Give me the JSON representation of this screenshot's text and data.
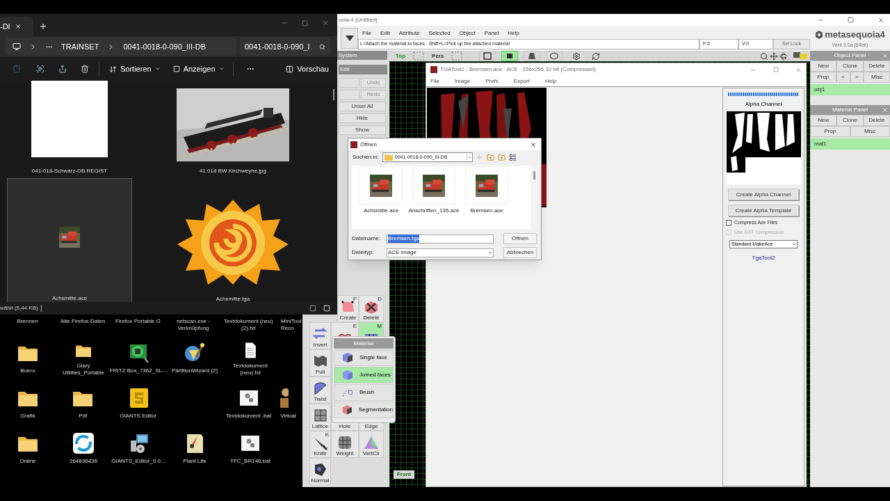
{
  "explorer": {
    "tab_title": "-DI",
    "path": [
      "TRAINSET",
      "0041-0018-0-090_III-DB"
    ],
    "search": {
      "value": "0041-0018-0-090_I"
    },
    "toolbar": {
      "sort": "Sortieren",
      "view": "Anzeigen",
      "preview": "Vorschau"
    },
    "files": [
      {
        "name": "041-018-Schwarz-DB.REGIST",
        "kind": "blank",
        "selected": false
      },
      {
        "name": "41 018 BW Kirchweyhe.jpg",
        "selected": false
      },
      {
        "name": "Achsmitte.ace",
        "kind": "thumb",
        "selected": true
      },
      {
        "name": "Achsmitte.tga",
        "kind": "logo",
        "selected": false
      }
    ],
    "status": "wählt (5,44 KB)"
  },
  "desktop": {
    "top_labels": [
      "Brennen",
      "Alte Firefox-Daten",
      "Firefox Portable G",
      "netscan.exe - Verknüpfung",
      "Textdokument (neu) (2).txt",
      "MiniTool Reco"
    ],
    "rows": [
      [
        {
          "name": "Buero",
          "kind": "folder"
        },
        {
          "name": "Glary Utilities_Portable",
          "kind": "folder"
        },
        {
          "name": "FRITZ.Box_7362_SL-...",
          "kind": "board"
        },
        {
          "name": "PartitionWizard (2)",
          "kind": "wizard"
        },
        {
          "name": "Textdokument (neu).txt",
          "kind": "document"
        }
      ],
      [
        {
          "name": "Grafik",
          "kind": "folder"
        },
        {
          "name": "Pdf",
          "kind": "folder"
        },
        {
          "name": "GIANTS Editor",
          "kind": "tile"
        },
        {
          "kind": "gap"
        },
        {
          "name": "Textdokument .bat",
          "kind": "script"
        },
        {
          "name": "Virtual",
          "kind": "figure"
        }
      ],
      [
        {
          "name": "Online",
          "kind": "folder"
        },
        {
          "name": "264836436",
          "kind": "sync"
        },
        {
          "name": "GIANTS_Editor_9.0....",
          "kind": "installer"
        },
        {
          "name": "Plant Life",
          "kind": "rocket"
        },
        {
          "name": "TFC_BR146.bat",
          "kind": "script"
        }
      ]
    ]
  },
  "meta": {
    "title": "uoia 4 [Untitled]",
    "menu": [
      "File",
      "Edit",
      "Attribute",
      "Selected",
      "Object",
      "Panel",
      "Help"
    ],
    "hint": "L=Attach the material to faces.  Shift+L=Pick up the attached material",
    "faces": "F:0",
    "vertices": "V:0",
    "sel_lock": "Sel Lock",
    "logo": "metasequoia4",
    "version": "Ver4.9.0a (64bit)",
    "system_tab": "System",
    "edit_tab": "Edit",
    "edit_buttons": [
      {
        "label": "Undo",
        "disabled": true
      },
      {
        "label": "Redo",
        "disabled": true
      },
      {
        "label": "Unsel All",
        "disabled": false
      },
      {
        "label": "Hide",
        "disabled": false
      },
      {
        "label": "Show",
        "disabled": false
      }
    ],
    "views": [
      {
        "label": "Top",
        "selected": true
      },
      {
        "label": "Pers",
        "selected": false
      }
    ],
    "shading_buttons": [
      {
        "selected": false
      },
      {
        "selected": true
      },
      {
        "selected": false
      },
      {
        "selected": false
      }
    ],
    "tool_rows": [
      [
        {
          "label": "Create",
          "key": "F",
          "selected": false
        },
        {
          "label": "Delete",
          "key": "D",
          "selected": false
        }
      ],
      [
        {
          "label": "Invert",
          "selected": false
        },
        {
          "key": "E",
          "selected": false
        },
        {
          "key": "M",
          "selected": true
        }
      ],
      [
        {
          "label": "Pull",
          "selected": false
        }
      ],
      [
        {
          "label": "Twist",
          "selected": false
        }
      ],
      [
        {
          "label": "Lattice",
          "selected": false
        },
        {
          "label": "Hole",
          "selected": false
        },
        {
          "label": "Edge",
          "selected": false
        }
      ],
      [
        {
          "label": "Knife",
          "key": "K",
          "selected": false
        },
        {
          "label": "Weight",
          "selected": false
        },
        {
          "label": "VertClr",
          "selected": false
        }
      ],
      [
        {
          "label": "Normal",
          "selected": false
        }
      ]
    ],
    "viewport_label": "Front",
    "object_panel": {
      "title": "Object Panel",
      "buttons": [
        "New",
        "Clone",
        "Delete"
      ],
      "buttons2": [
        "Prop",
        "<",
        ">",
        "Misc"
      ],
      "items": [
        {
          "name": "obj1",
          "selected": true
        }
      ]
    },
    "material_panel": {
      "title": "Material Panel",
      "buttons": [
        "New",
        "Clone",
        "Delete"
      ],
      "buttons2": [
        "Prop",
        "Misc"
      ],
      "items": [
        {
          "name": "mat1",
          "selected": true
        }
      ]
    },
    "material_menu": {
      "title": "Material",
      "items": [
        {
          "label": "Single face",
          "selected": false
        },
        {
          "label": "Joined faces",
          "selected": true
        },
        {
          "label": "Brush",
          "selected": false
        },
        {
          "label": "Segmentation",
          "selected": false
        }
      ]
    }
  },
  "tgatool": {
    "title": "TGATool2 - Bremsen.ace   ACE : 256x256 32 bit (Compressed)",
    "menu": [
      "File",
      "Image",
      "Prefs",
      "Export",
      "Help"
    ],
    "progress": {
      "level": 1
    },
    "alpha_label": "Alpha Channel",
    "buttons": [
      "Create Alpha Channel",
      "Create Alpha Template"
    ],
    "options": [
      {
        "label": "Compress Ace Files",
        "checked": false,
        "disabled": false
      },
      {
        "label": "Use DXT Compression",
        "checked": false,
        "disabled": true
      }
    ],
    "format": "Standard MakeAce",
    "footer": "TgaTool2"
  },
  "dialog": {
    "title": "Öffnen",
    "look_in_label": "Suchen in:",
    "look_in": "0041-0018-0-090_III-DB",
    "files": [
      "Achsmitte.ace",
      "Anschriften_135.ace",
      "Bremsen.ace"
    ],
    "filename_label": "Dateiname:",
    "filename": "Bremsen.tga",
    "filetype_label": "Dateityp:",
    "filetype": "ACE Image",
    "open": "Öffnen",
    "cancel": "Abbrechen"
  }
}
